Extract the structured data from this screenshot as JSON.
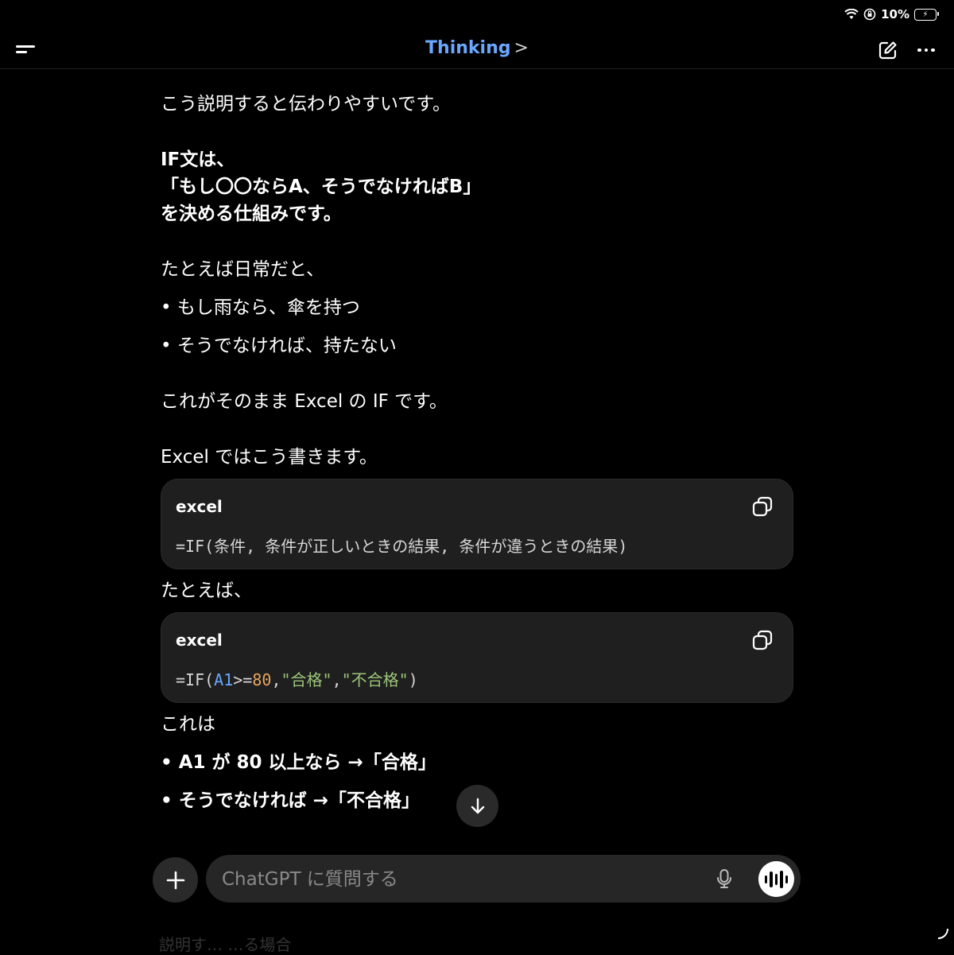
{
  "status": {
    "battery_percent": "10%"
  },
  "header": {
    "title": "Thinking",
    "title_chevron": ">"
  },
  "message": {
    "intro": "こう説明すると伝わりやすいです。",
    "def_line1": "IF文は、",
    "def_line2": "「もし〇〇ならA、そうでなければB」",
    "def_line3": "を決める仕組みです。",
    "example_intro": "たとえば日常だと、",
    "daily_bullets": [
      "もし雨なら、傘を持つ",
      "そうでなければ、持たない"
    ],
    "excel_note": "これがそのまま Excel の IF です。",
    "excel_intro": "Excel ではこう書きます。",
    "code_block_1": {
      "lang": "excel",
      "code": "=IF(条件, 条件が正しいときの結果, 条件が違うときの結果)"
    },
    "example_label": "たとえば、",
    "code_block_2": {
      "lang": "excel",
      "code_parts": [
        "=IF(",
        "A1",
        ">=",
        "80",
        ",",
        "\"合格\"",
        ",",
        "\"不合格\"",
        ")"
      ]
    },
    "explain_label": "これは",
    "explain_bullets": [
      "A1 が 80 以上なら →「合格」",
      "そうでなければ →「不合格」"
    ]
  },
  "composer": {
    "placeholder": "ChatGPT に質問する"
  },
  "footer_faded": "説明す…  …る場合"
}
